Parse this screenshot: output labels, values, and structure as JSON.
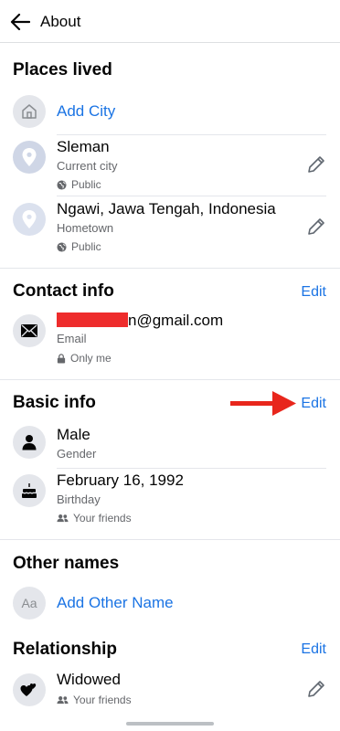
{
  "header": {
    "title": "About"
  },
  "places": {
    "title": "Places lived",
    "add_city": "Add City",
    "items": [
      {
        "name": "Sleman",
        "label": "Current city",
        "privacy": "Public"
      },
      {
        "name": "Ngawi, Jawa Tengah, Indonesia",
        "label": "Hometown",
        "privacy": "Public"
      }
    ]
  },
  "contact": {
    "title": "Contact info",
    "edit": "Edit",
    "email_visible": "n@gmail.com",
    "email_label": "Email",
    "privacy": "Only me"
  },
  "basic": {
    "title": "Basic info",
    "edit": "Edit",
    "gender": "Male",
    "gender_label": "Gender",
    "birthday": "February 16, 1992",
    "birthday_label": "Birthday",
    "birthday_privacy": "Your friends"
  },
  "other_names": {
    "title": "Other names",
    "add": "Add Other Name",
    "icon_text": "Aa"
  },
  "relationship": {
    "title": "Relationship",
    "edit": "Edit",
    "status": "Widowed",
    "privacy": "Your friends"
  },
  "colors": {
    "link": "#1b74e4",
    "annotation_arrow": "#e8261c",
    "redaction": "#ee2c2c"
  }
}
